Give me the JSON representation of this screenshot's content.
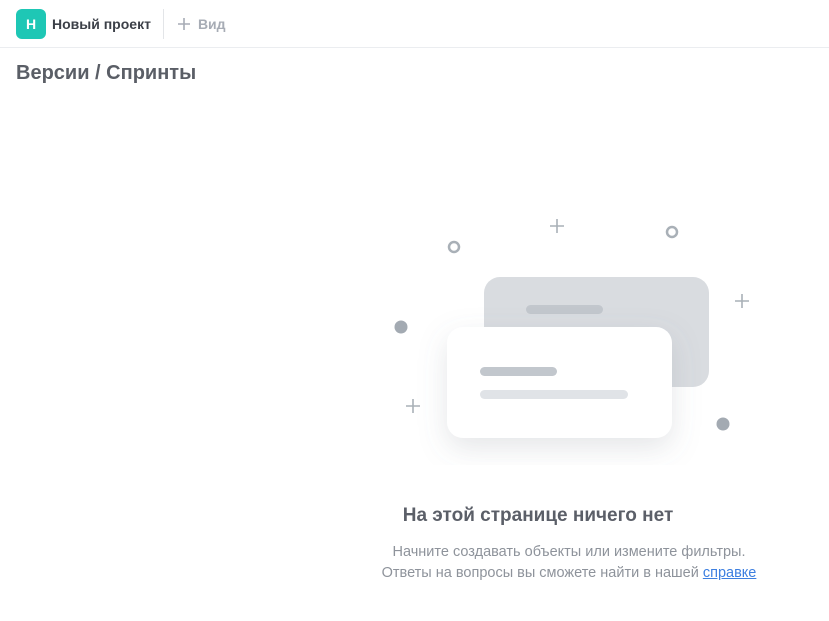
{
  "header": {
    "project": {
      "avatar_letter": "Н",
      "name": "Новый проект",
      "avatar_color": "#1ec7b5"
    },
    "add_view": {
      "icon": "plus-icon",
      "label": "Вид"
    }
  },
  "page": {
    "title": "Версии / Спринты"
  },
  "empty_state": {
    "title": "На этой странице ничего нет",
    "line1": "Начните создавать объекты или измените фильтры.",
    "line2_prefix": "Ответы на вопросы вы сможете найти в нашей",
    "help_link": "справке"
  }
}
